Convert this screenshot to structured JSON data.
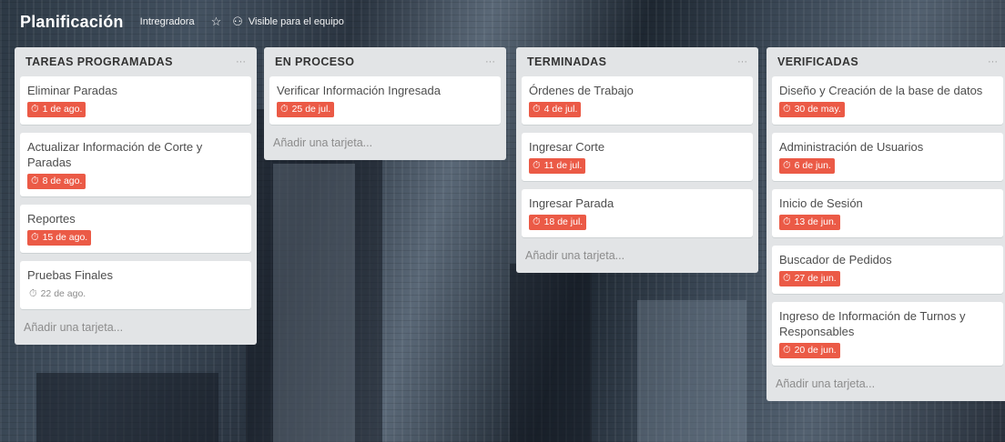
{
  "board": {
    "title": "Planificación",
    "team": "Intregradora",
    "star_icon": "star-icon",
    "visibility_icon": "people-icon",
    "visibility": "Visible para el equipo"
  },
  "colors": {
    "due_badge": "#eb5a46",
    "list_bg": "#e2e4e6",
    "card_bg": "#ffffff"
  },
  "lists": [
    {
      "title": "TAREAS PROGRAMADAS",
      "menu": "···",
      "add_card": "Añadir una tarjeta...",
      "cards": [
        {
          "title": "Eliminar Paradas",
          "due": "1 de ago."
        },
        {
          "title": "Actualizar Información de Corte y Paradas",
          "due": "8 de ago."
        },
        {
          "title": "Reportes",
          "due": "15 de ago."
        },
        {
          "title": "Pruebas Finales",
          "due": "22 de ago."
        }
      ]
    },
    {
      "title": "EN PROCESO",
      "menu": "···",
      "add_card": "Añadir una tarjeta...",
      "cards": [
        {
          "title": "Verificar Información Ingresada",
          "due": "25 de jul."
        }
      ]
    },
    {
      "title": "TERMINADAS",
      "menu": "···",
      "add_card": "Añadir una tarjeta...",
      "cards": [
        {
          "title": "Órdenes de Trabajo",
          "due": "4 de jul."
        },
        {
          "title": "Ingresar Corte",
          "due": "11 de jul."
        },
        {
          "title": "Ingresar Parada",
          "due": "18 de jul."
        }
      ]
    },
    {
      "title": "VERIFICADAS",
      "menu": "···",
      "add_card": "Añadir una tarjeta...",
      "cards": [
        {
          "title": "Diseño y Creación de la base de datos",
          "due": "30 de may."
        },
        {
          "title": "Administración de Usuarios",
          "due": "6 de jun."
        },
        {
          "title": "Inicio de Sesión",
          "due": "13 de jun."
        },
        {
          "title": "Buscador de Pedidos",
          "due": "27 de jun."
        },
        {
          "title": "Ingreso de Información de Turnos y Responsables",
          "due": "20 de jun."
        }
      ]
    }
  ]
}
